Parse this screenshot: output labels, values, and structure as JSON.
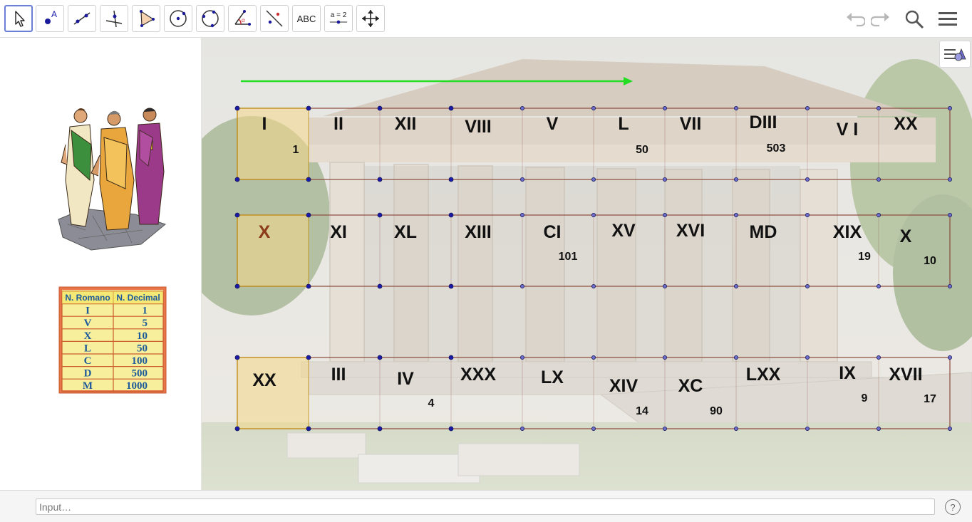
{
  "toolbar": {
    "tools": [
      {
        "name": "move-tool",
        "label": ""
      },
      {
        "name": "point-tool",
        "label": "A"
      },
      {
        "name": "line-tool",
        "label": ""
      },
      {
        "name": "perpendicular-line-tool",
        "label": ""
      },
      {
        "name": "polygon-tool",
        "label": ""
      },
      {
        "name": "circle-center-point-tool",
        "label": ""
      },
      {
        "name": "circle-three-points-tool",
        "label": ""
      },
      {
        "name": "angle-tool",
        "label": "α"
      },
      {
        "name": "reflect-tool",
        "label": ""
      },
      {
        "name": "text-tool",
        "label": "ABC"
      },
      {
        "name": "slider-tool",
        "label": "a = 2"
      },
      {
        "name": "move-graphics-view-tool",
        "label": ""
      }
    ],
    "right_icons": [
      "undo-icon",
      "redo-icon",
      "search-icon",
      "menu-icon"
    ]
  },
  "reference_table": {
    "headers": [
      "N. Romano",
      "N. Decimal"
    ],
    "rows": [
      [
        "I",
        "1"
      ],
      [
        "V",
        "5"
      ],
      [
        "X",
        "10"
      ],
      [
        "L",
        "50"
      ],
      [
        "C",
        "100"
      ],
      [
        "D",
        "500"
      ],
      [
        "M",
        "1000"
      ]
    ]
  },
  "board": {
    "rows": [
      {
        "cells": [
          {
            "roman": "I",
            "number": "1"
          },
          {
            "roman": "II",
            "number": ""
          },
          {
            "roman": "XII",
            "number": ""
          },
          {
            "roman": "VIII",
            "number": ""
          },
          {
            "roman": "V",
            "number": ""
          },
          {
            "roman": "L",
            "number": "50"
          },
          {
            "roman": "VII",
            "number": ""
          },
          {
            "roman": "DIII",
            "number": "503"
          },
          {
            "roman": "V I",
            "number": ""
          },
          {
            "roman": "XX",
            "number": ""
          }
        ]
      },
      {
        "cells": [
          {
            "roman": "X",
            "number": ""
          },
          {
            "roman": "XI",
            "number": ""
          },
          {
            "roman": "XL",
            "number": ""
          },
          {
            "roman": "XIII",
            "number": ""
          },
          {
            "roman": "CI",
            "number": "101"
          },
          {
            "roman": "XV",
            "number": ""
          },
          {
            "roman": "XVI",
            "number": ""
          },
          {
            "roman": "MD",
            "number": ""
          },
          {
            "roman": "XIX",
            "number": "19"
          },
          {
            "roman": "X",
            "number": "10"
          }
        ]
      },
      {
        "cells": [
          {
            "roman": "XX",
            "number": ""
          },
          {
            "roman": "III",
            "number": ""
          },
          {
            "roman": "IV",
            "number": "4"
          },
          {
            "roman": "XXX",
            "number": ""
          },
          {
            "roman": "LX",
            "number": ""
          },
          {
            "roman": "XIV",
            "number": "14"
          },
          {
            "roman": "XC",
            "number": "90"
          },
          {
            "roman": "LXX",
            "number": ""
          },
          {
            "roman": "IX",
            "number": "9"
          },
          {
            "roman": "XVII",
            "number": "17"
          }
        ]
      }
    ]
  },
  "colors": {
    "highlight_fill": "#f5d98a",
    "highlight_border": "#e6b800",
    "grid_line": "#8b4a3c",
    "arrow": "#22dd22",
    "point": "#1a1aa8",
    "accent_label": "#8b3a1a"
  },
  "input_bar": {
    "placeholder": "Input…",
    "help": "?"
  }
}
